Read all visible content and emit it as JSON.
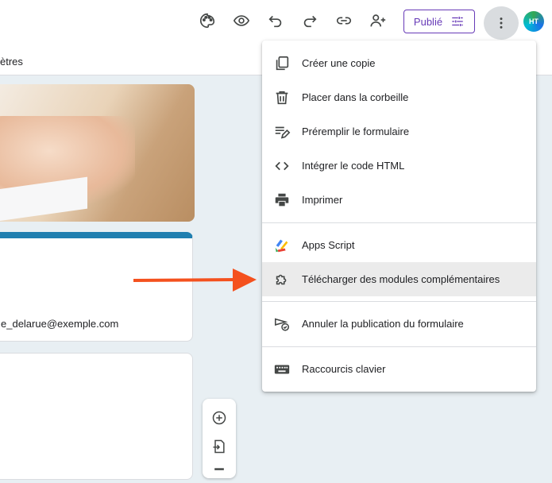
{
  "tabs": {
    "params_partial": "ètres"
  },
  "toolbar": {
    "icons": [
      "palette-icon",
      "eye-icon",
      "undo-icon",
      "redo-icon",
      "link-icon",
      "add-person-icon"
    ],
    "publish_label": "Publié",
    "avatar_initials": "HT"
  },
  "form": {
    "email": "e_delarue@exemple.com"
  },
  "menu": {
    "items": [
      {
        "label": "Créer une copie",
        "icon": "copy-icon"
      },
      {
        "label": "Placer dans la corbeille",
        "icon": "trash-icon"
      },
      {
        "label": "Préremplir le formulaire",
        "icon": "prefill-icon"
      },
      {
        "label": "Intégrer le code HTML",
        "icon": "code-icon"
      },
      {
        "label": "Imprimer",
        "icon": "print-icon"
      },
      {
        "label": "Apps Script",
        "icon": "apps-script-icon"
      },
      {
        "label": "Télécharger des modules complémentaires",
        "icon": "puzzle-icon"
      },
      {
        "label": "Annuler la publication du formulaire",
        "icon": "unpublish-icon"
      },
      {
        "label": "Raccourcis clavier",
        "icon": "keyboard-icon"
      }
    ]
  },
  "colors": {
    "accent": "#673ab7",
    "arrow": "#f4511e",
    "theme": "#1f7fb0"
  }
}
